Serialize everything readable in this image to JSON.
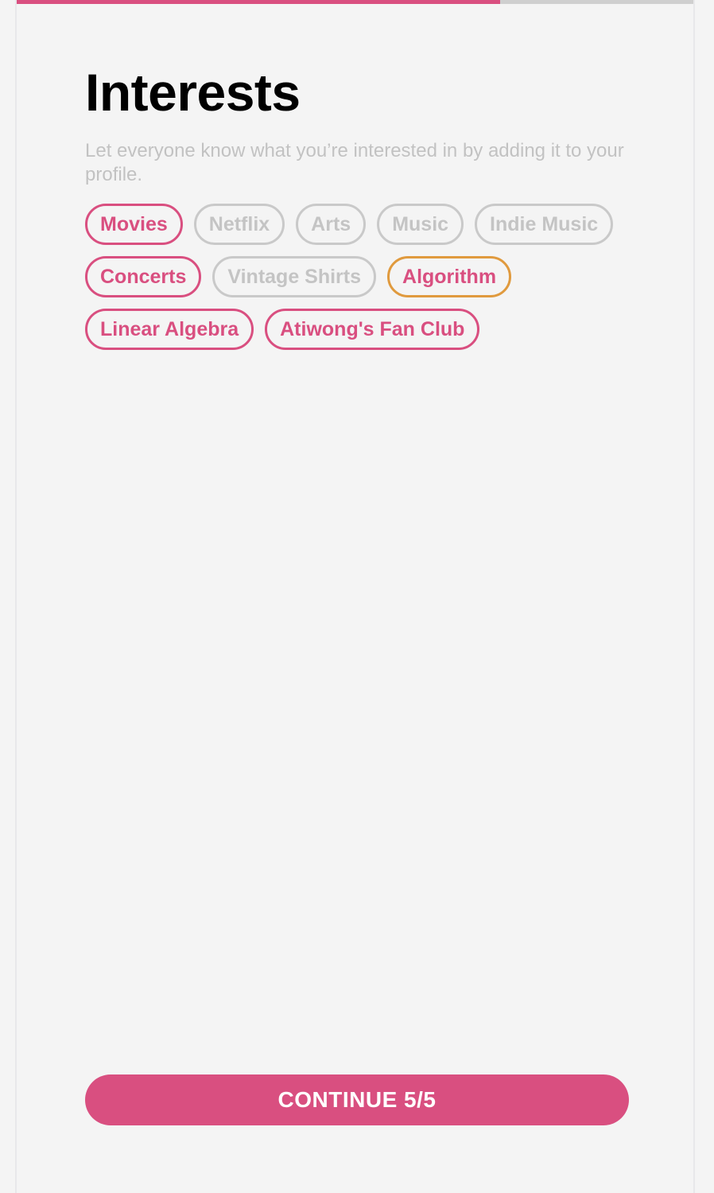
{
  "progress": {
    "fraction": 0.714,
    "fill_color": "#d94f80",
    "track_color": "#cfcfcf"
  },
  "title": "Interests",
  "subtitle": "Let everyone know what you’re interested in by adding it to your profile.",
  "colors": {
    "accent": "#d94f80",
    "focus_outline": "#e09a3e",
    "unselected": "#c4c4c4"
  },
  "interests": [
    {
      "label": "Movies",
      "state": "selected"
    },
    {
      "label": "Netflix",
      "state": "unselected"
    },
    {
      "label": "Arts",
      "state": "unselected"
    },
    {
      "label": "Music",
      "state": "unselected"
    },
    {
      "label": "Indie Music",
      "state": "unselected"
    },
    {
      "label": "Concerts",
      "state": "selected"
    },
    {
      "label": "Vintage Shirts",
      "state": "unselected"
    },
    {
      "label": "Algorithm",
      "state": "focused"
    },
    {
      "label": "Linear Algebra",
      "state": "selected"
    },
    {
      "label": "Atiwong's Fan Club",
      "state": "selected"
    }
  ],
  "continue_button": {
    "label": "CONTINUE 5/5"
  }
}
